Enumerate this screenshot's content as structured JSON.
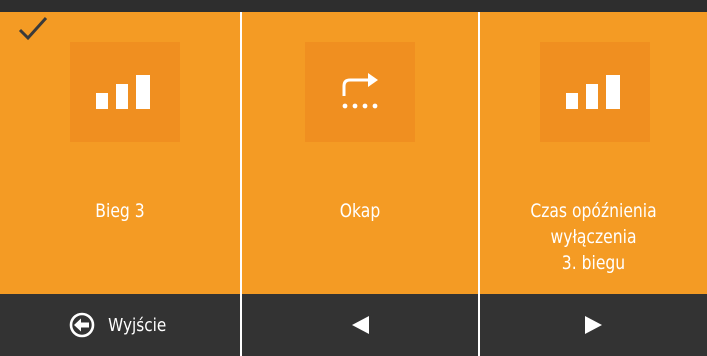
{
  "colors": {
    "tile_bg": "#f49b24",
    "icon_bg": "#f08f20",
    "bar_bg": "#333333",
    "divider": "#ffffff",
    "text": "#ffffff"
  },
  "tiles": [
    {
      "icon": "signal-bars-icon",
      "label_lines": [
        "Bieg 3"
      ],
      "selected": true,
      "selected_icon": "checkmark-icon"
    },
    {
      "icon": "redirect-arrow-icon",
      "label_lines": [
        "Okap"
      ],
      "selected": false
    },
    {
      "icon": "signal-bars-icon",
      "label_lines": [
        "Czas opóźnienia",
        "wyłączenia",
        "3. biegu"
      ],
      "selected": false
    }
  ],
  "bottom_bar": {
    "exit": {
      "icon": "exit-arrow-icon",
      "label": "Wyjście"
    },
    "prev": {
      "icon": "triangle-left-icon"
    },
    "next": {
      "icon": "triangle-right-icon"
    }
  }
}
